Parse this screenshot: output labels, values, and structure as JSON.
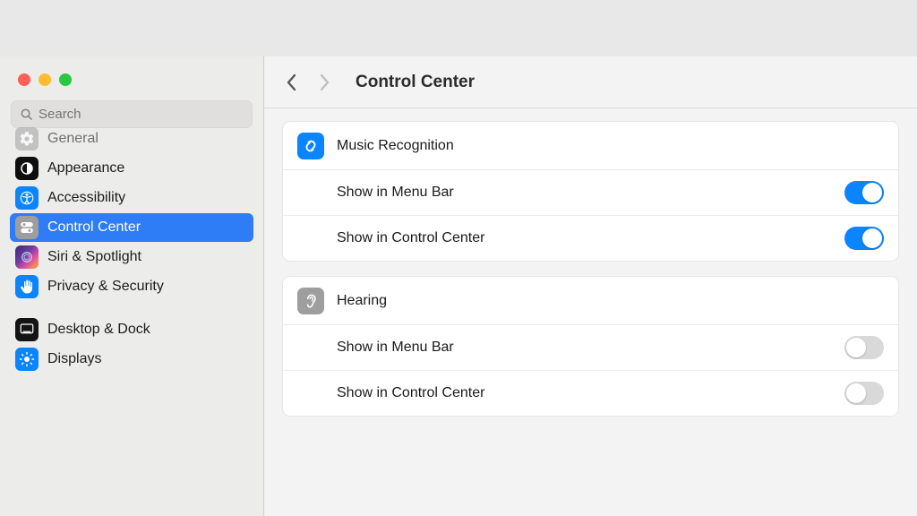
{
  "search": {
    "placeholder": "Search"
  },
  "sidebar": {
    "items": [
      {
        "label": "General"
      },
      {
        "label": "Appearance"
      },
      {
        "label": "Accessibility"
      },
      {
        "label": "Control Center"
      },
      {
        "label": "Siri & Spotlight"
      },
      {
        "label": "Privacy & Security"
      },
      {
        "label": "Desktop & Dock"
      },
      {
        "label": "Displays"
      }
    ]
  },
  "header": {
    "title": "Control Center"
  },
  "sections": [
    {
      "title": "Music Recognition",
      "rows": [
        {
          "label": "Show in Menu Bar",
          "on": true
        },
        {
          "label": "Show in Control Center",
          "on": true
        }
      ]
    },
    {
      "title": "Hearing",
      "rows": [
        {
          "label": "Show in Menu Bar",
          "on": false
        },
        {
          "label": "Show in Control Center",
          "on": false
        }
      ]
    }
  ]
}
